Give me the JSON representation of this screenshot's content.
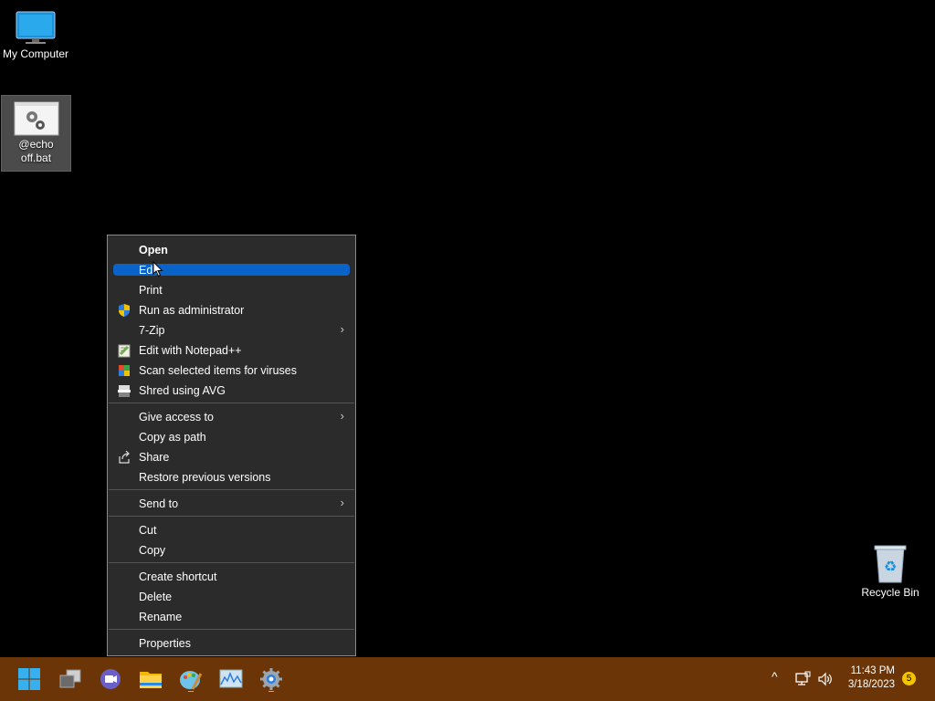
{
  "desktop": {
    "icons": [
      {
        "label": "My Computer"
      },
      {
        "label": "@echo off.bat"
      },
      {
        "label": "Recycle Bin"
      }
    ]
  },
  "context_menu": {
    "items": [
      {
        "label": "Open",
        "bold": true
      },
      {
        "label": "Edit",
        "highlighted": true
      },
      {
        "label": "Print"
      },
      {
        "label": "Run as administrator",
        "icon": "uac-shield-icon"
      },
      {
        "label": "7-Zip",
        "submenu": true
      },
      {
        "label": "Edit with Notepad++",
        "icon": "notepadpp-icon"
      },
      {
        "label": "Scan selected items for viruses",
        "icon": "avg-scan-icon"
      },
      {
        "label": "Shred using AVG",
        "icon": "avg-shred-icon"
      },
      {
        "label": "Give access to",
        "submenu": true
      },
      {
        "label": "Copy as path"
      },
      {
        "label": "Share",
        "icon": "share-icon"
      },
      {
        "label": "Restore previous versions"
      },
      {
        "label": "Send to",
        "submenu": true
      },
      {
        "label": "Cut"
      },
      {
        "label": "Copy"
      },
      {
        "label": "Create shortcut"
      },
      {
        "label": "Delete"
      },
      {
        "label": "Rename"
      },
      {
        "label": "Properties"
      }
    ],
    "submenu_arrow": "›"
  },
  "taskbar": {
    "apps": [
      "windows-start-icon",
      "task-view-icon",
      "teams-chat-icon",
      "file-explorer-icon",
      "paint-icon",
      "resource-monitor-icon",
      "settings-icon"
    ],
    "tray": {
      "time": "11:43 PM",
      "date": "3/18/2023",
      "notification_count": "5",
      "chevron": "^"
    }
  },
  "colors": {
    "taskbar": "#6b3507",
    "menu_bg": "#2b2b2b",
    "highlight": "#0a63c9",
    "badge": "#f5c400"
  }
}
